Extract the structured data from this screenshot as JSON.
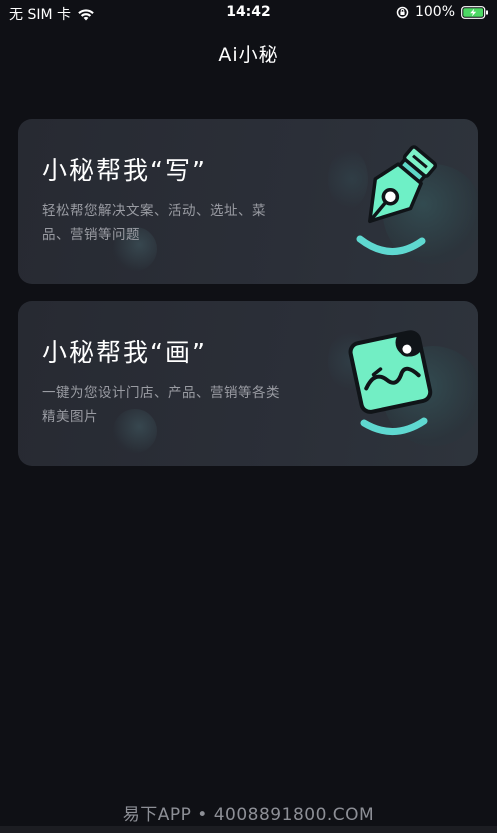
{
  "status_bar": {
    "carrier": "无 SIM 卡",
    "time": "14:42",
    "battery_percent": "100%",
    "icons": [
      "wifi-icon",
      "orientation-lock-icon",
      "battery-charging-icon"
    ]
  },
  "nav": {
    "title": "Ai小秘"
  },
  "cards": [
    {
      "title": "小秘帮我“写”",
      "description": "轻松帮您解决文案、活动、选址、菜品、营销等问题",
      "icon": "pen-nib-icon"
    },
    {
      "title": "小秘帮我“画”",
      "description": "一键为您设计门店、产品、营销等各类精美图片",
      "icon": "picture-icon"
    }
  ],
  "watermark": "易下APP • 4008891800.COM",
  "colors": {
    "background": "#0f1015",
    "card": "#2b2f38",
    "accent_mint": "#7df2c8",
    "accent_teal": "#5fd8d0",
    "outline": "#101418",
    "text_secondary": "#9a9ca3"
  }
}
